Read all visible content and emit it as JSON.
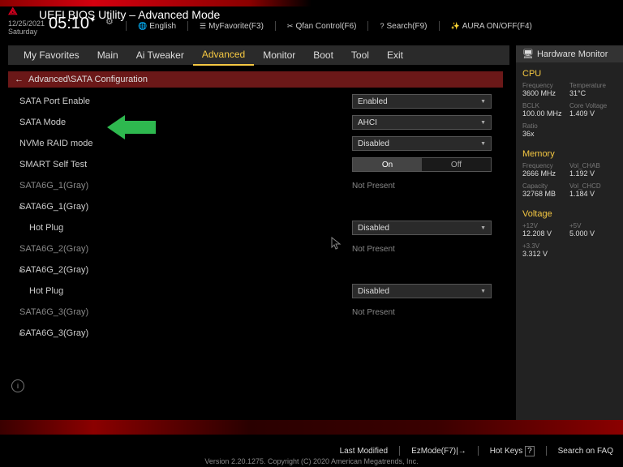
{
  "header": {
    "title": "UEFI BIOS Utility – Advanced Mode",
    "date": "12/25/2021",
    "day": "Saturday",
    "time": "05:10",
    "lang": "English",
    "myfav": "MyFavorite(F3)",
    "qfan": "Qfan Control(F6)",
    "search": "Search(F9)",
    "aura": "AURA ON/OFF(F4)"
  },
  "tabs": [
    "My Favorites",
    "Main",
    "Ai Tweaker",
    "Advanced",
    "Monitor",
    "Boot",
    "Tool",
    "Exit"
  ],
  "breadcrumb": "Advanced\\SATA Configuration",
  "settings": [
    {
      "label": "SATA Port Enable",
      "type": "dropdown",
      "value": "Enabled"
    },
    {
      "label": "SATA Mode",
      "type": "dropdown",
      "value": "AHCI"
    },
    {
      "label": "NVMe RAID mode",
      "type": "dropdown",
      "value": "Disabled"
    },
    {
      "label": "SMART Self Test",
      "type": "toggle",
      "on": "On",
      "off": "Off"
    },
    {
      "label": "SATA6G_1(Gray)",
      "type": "text",
      "value": "Not Present",
      "sub": true
    },
    {
      "label": "SATA6G_1(Gray)",
      "type": "expand"
    },
    {
      "label": "Hot Plug",
      "type": "dropdown",
      "value": "Disabled",
      "indent": true
    },
    {
      "label": "SATA6G_2(Gray)",
      "type": "text",
      "value": "Not Present",
      "sub": true
    },
    {
      "label": "SATA6G_2(Gray)",
      "type": "expand"
    },
    {
      "label": "Hot Plug",
      "type": "dropdown",
      "value": "Disabled",
      "indent": true
    },
    {
      "label": "SATA6G_3(Gray)",
      "type": "text",
      "value": "Not Present",
      "sub": true
    },
    {
      "label": "SATA6G_3(Gray)",
      "type": "expand"
    }
  ],
  "hw": {
    "title": "Hardware Monitor",
    "cpu": {
      "title": "CPU",
      "rows": [
        [
          "Frequency",
          "3600 MHz",
          "Temperature",
          "31°C"
        ],
        [
          "BCLK",
          "100.00 MHz",
          "Core Voltage",
          "1.409 V"
        ],
        [
          "Ratio",
          "36x",
          "",
          ""
        ]
      ]
    },
    "mem": {
      "title": "Memory",
      "rows": [
        [
          "Frequency",
          "2666 MHz",
          "Vol_CHAB",
          "1.192 V"
        ],
        [
          "Capacity",
          "32768 MB",
          "Vol_CHCD",
          "1.184 V"
        ]
      ]
    },
    "volt": {
      "title": "Voltage",
      "rows": [
        [
          "+12V",
          "12.208 V",
          "+5V",
          "5.000 V"
        ],
        [
          "+3.3V",
          "3.312 V",
          "",
          ""
        ]
      ]
    }
  },
  "footer": {
    "last": "Last Modified",
    "ez": "EzMode(F7)",
    "hot": "Hot Keys",
    "faq": "Search on FAQ",
    "copy": "Version 2.20.1275. Copyright (C) 2020 American Megatrends, Inc."
  }
}
